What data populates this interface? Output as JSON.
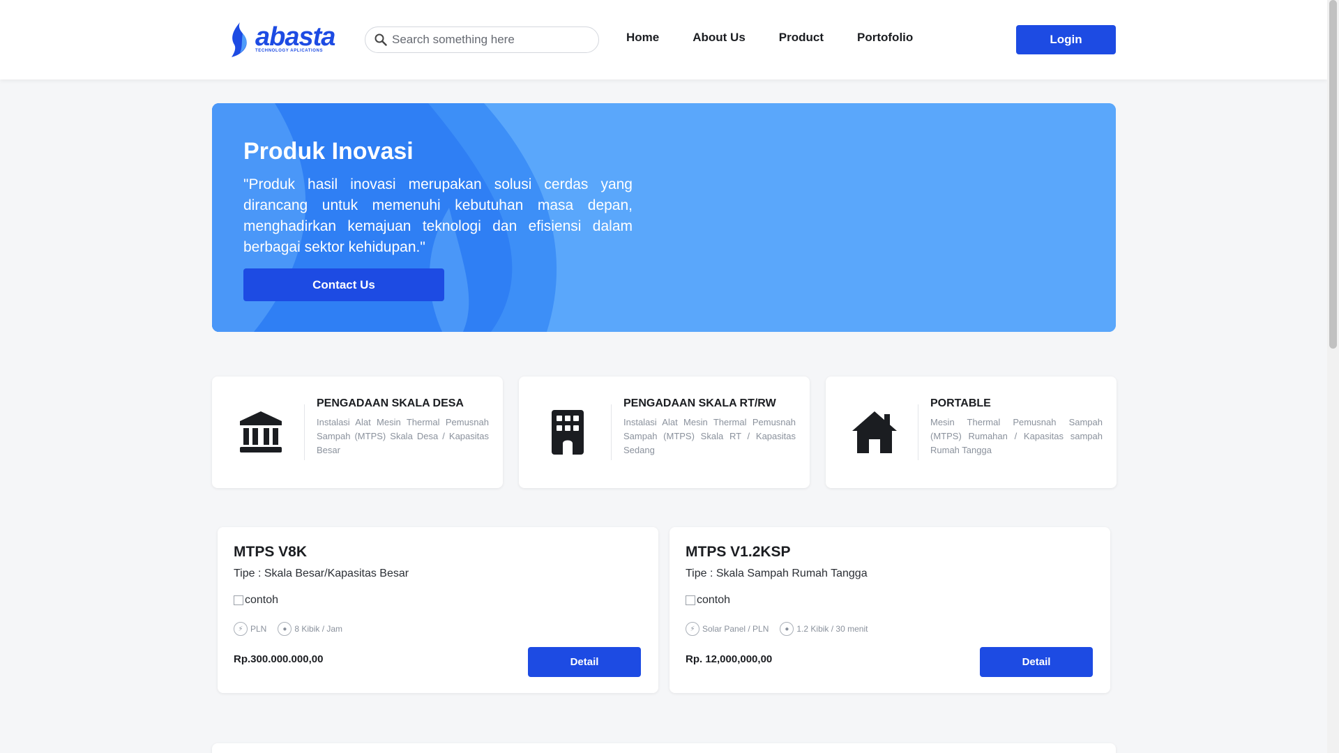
{
  "brand": {
    "name": "abasta",
    "tagline": "TECHNOLOGY APLICATIONS"
  },
  "search": {
    "placeholder": "Search something here"
  },
  "nav": {
    "items": [
      "Home",
      "About Us",
      "Product",
      "Portofolio"
    ]
  },
  "header": {
    "login_label": "Login"
  },
  "hero": {
    "title": "Produk Inovasi",
    "text": "\"Produk hasil inovasi merupakan solusi cerdas yang dirancang untuk memenuhi kebutuhan masa depan, menghadirkan kemajuan teknologi dan efisiensi dalam berbagai sektor kehidupan.\"",
    "cta_label": "Contact Us"
  },
  "categories": [
    {
      "icon": "bank-icon",
      "title": "PENGADAAN SKALA DESA",
      "desc": "Instalasi Alat Mesin Thermal Pemusnah Sampah (MTPS) Skala Desa / Kapasitas Besar"
    },
    {
      "icon": "building-icon",
      "title": "PENGADAAN SKALA RT/RW",
      "desc": "Instalasi Alat Mesin Thermal Pemusnah Sampah (MTPS) Skala RT / Kapasitas Sedang"
    },
    {
      "icon": "house-icon",
      "title": "PORTABLE",
      "desc": "Mesin Thermal Pemusnah Sampah (MTPS) Rumahan / Kapasitas sampah Rumah Tangga"
    }
  ],
  "products": [
    {
      "name": "MTPS V8K",
      "type": "Tipe : Skala Besar/Kapasitas Besar",
      "image_alt": "contoh",
      "power": "PLN",
      "capacity": "8 Kibik / Jam",
      "price": "Rp.300.000.000,00",
      "detail_label": "Detail"
    },
    {
      "name": "MTPS V1.2KSP",
      "type": "Tipe : Skala Sampah Rumah Tangga",
      "image_alt": "contoh",
      "power": "Solar Panel / PLN",
      "capacity": "1.2 Kibik / 30 menit",
      "price": "Rp. 12,000,000,00",
      "detail_label": "Detail"
    }
  ],
  "colors": {
    "primary": "#1d4be3",
    "hero_bg": "#5aa7fb",
    "background": "#f5f6f8"
  }
}
